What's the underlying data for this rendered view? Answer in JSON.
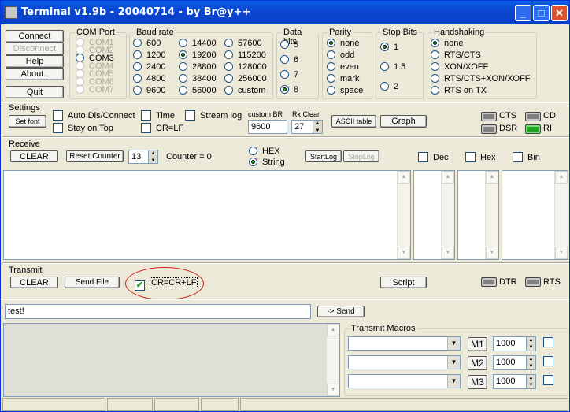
{
  "window": {
    "title": "Terminal v1.9b - 20040714 - by Br@y++",
    "min": "_",
    "max": "□",
    "close": "✕"
  },
  "left_buttons": {
    "connect": "Connect",
    "disconnect": "Disconnect",
    "help": "Help",
    "about": "About..",
    "quit": "Quit"
  },
  "com_port": {
    "label": "COM Port",
    "options": [
      "COM1",
      "COM2",
      "COM3",
      "COM4",
      "COM5",
      "COM6",
      "COM7"
    ],
    "enabled": [
      "COM3"
    ]
  },
  "baud_rate": {
    "label": "Baud rate",
    "col1": [
      "600",
      "1200",
      "2400",
      "4800",
      "9600"
    ],
    "col2": [
      "14400",
      "19200",
      "28800",
      "38400",
      "56000"
    ],
    "col3": [
      "57600",
      "115200",
      "128000",
      "256000",
      "custom"
    ],
    "selected": "19200"
  },
  "data_bits": {
    "label": "Data bits",
    "options": [
      "5",
      "6",
      "7",
      "8"
    ],
    "selected": "8"
  },
  "parity": {
    "label": "Parity",
    "options": [
      "none",
      "odd",
      "even",
      "mark",
      "space"
    ],
    "selected": "none"
  },
  "stop_bits": {
    "label": "Stop Bits",
    "options": [
      "1",
      "1.5",
      "2"
    ],
    "selected": "1"
  },
  "handshaking": {
    "label": "Handshaking",
    "options": [
      "none",
      "RTS/CTS",
      "XON/XOFF",
      "RTS/CTS+XON/XOFF",
      "RTS on TX"
    ],
    "selected": "none"
  },
  "settings": {
    "label": "Settings",
    "set_font": "Set font",
    "auto_dis_connect": "Auto Dis/Connect",
    "stay_on_top": "Stay on Top",
    "time": "Time",
    "cr_lf": "CR=LF",
    "stream_log": "Stream log",
    "custom_br_label": "custom BR",
    "custom_br_value": "9600",
    "rx_clear_label": "Rx Clear",
    "rx_clear_value": "27",
    "ascii_table": "ASCII table",
    "graph": "Graph"
  },
  "signals": {
    "cts": "CTS",
    "cd": "CD",
    "dsr": "DSR",
    "ri": "RI",
    "ri_active": true
  },
  "receive": {
    "label": "Receive",
    "clear": "CLEAR",
    "reset_counter": "Reset Counter",
    "counter_spin": "13",
    "counter_text": "Counter = 0",
    "hex": "HEX",
    "string": "String",
    "selected": "String",
    "startlog": "StartLog",
    "stoplog": "StopLog",
    "dec": "Dec",
    "hex_chk": "Hex",
    "bin": "Bin"
  },
  "transmit": {
    "label": "Transmit",
    "clear": "CLEAR",
    "send_file": "Send File",
    "cr_crlf": "CR=CR+LF",
    "cr_crlf_checked": true,
    "script": "Script",
    "dtr": "DTR",
    "rts": "RTS",
    "input_value": "test!",
    "send": "-> Send"
  },
  "macros": {
    "label": "Transmit Macros",
    "rows": [
      {
        "button": "M1",
        "interval": "1000"
      },
      {
        "button": "M2",
        "interval": "1000"
      },
      {
        "button": "M3",
        "interval": "1000"
      }
    ]
  },
  "icons": {
    "spin_up": "▲",
    "spin_down": "▼",
    "dropdown": "▼",
    "check": "✔"
  },
  "colors": {
    "titlebar": "#0a46d2",
    "face": "#ece9d8",
    "led_on": "#1aa51a",
    "led_off": "#808080",
    "highlight_circle": "#d02020"
  }
}
